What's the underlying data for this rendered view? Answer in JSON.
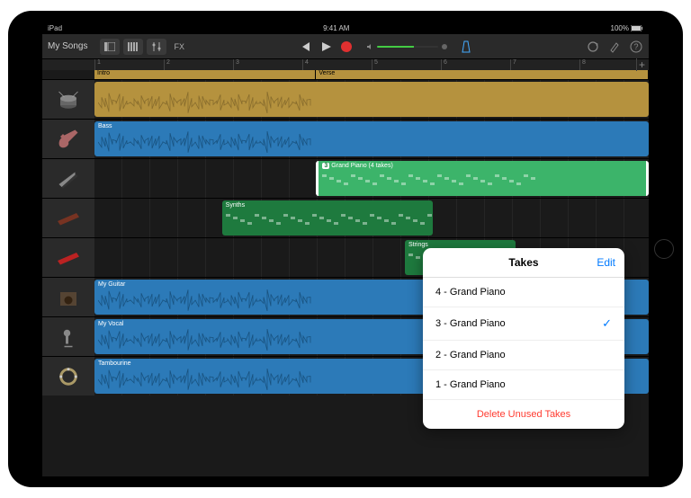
{
  "status": {
    "device": "iPad",
    "time": "9:41 AM",
    "battery": "100%"
  },
  "toolbar": {
    "my_songs": "My Songs",
    "fx": "FX"
  },
  "ruler": {
    "bars": [
      "1",
      "2",
      "3",
      "4",
      "5",
      "6",
      "7",
      "8"
    ]
  },
  "markers": [
    {
      "label": "Intro",
      "width": "40%"
    },
    {
      "label": "Verse",
      "width": "60%"
    }
  ],
  "tracks": [
    {
      "icon": "drums",
      "clips": [
        {
          "kind": "yellow",
          "left": "0%",
          "width": "100%",
          "label": ""
        }
      ]
    },
    {
      "icon": "guitar",
      "clips": [
        {
          "kind": "blue",
          "left": "0%",
          "width": "100%",
          "label": "Bass"
        }
      ]
    },
    {
      "icon": "piano",
      "clips": [
        {
          "kind": "green",
          "left": "40%",
          "width": "60%",
          "label": "Grand Piano (4 takes)",
          "takeNum": "3"
        }
      ]
    },
    {
      "icon": "keys",
      "clips": [
        {
          "kind": "darkgreen",
          "left": "23%",
          "width": "38%",
          "label": "Synths"
        }
      ]
    },
    {
      "icon": "keys2",
      "clips": [
        {
          "kind": "darkgreen",
          "left": "56%",
          "width": "20%",
          "label": "Strings"
        }
      ]
    },
    {
      "icon": "amp",
      "clips": [
        {
          "kind": "blue",
          "left": "0%",
          "width": "100%",
          "label": "My Guitar"
        }
      ]
    },
    {
      "icon": "mic",
      "clips": [
        {
          "kind": "blue",
          "left": "0%",
          "width": "100%",
          "label": "My Vocal"
        }
      ]
    },
    {
      "icon": "tamb",
      "clips": [
        {
          "kind": "blue",
          "left": "0%",
          "width": "100%",
          "label": "Tambourine"
        }
      ]
    }
  ],
  "popover": {
    "title": "Takes",
    "edit": "Edit",
    "items": [
      {
        "label": "4 - Grand Piano",
        "selected": false
      },
      {
        "label": "3 - Grand Piano",
        "selected": true
      },
      {
        "label": "2 - Grand Piano",
        "selected": false
      },
      {
        "label": "1 - Grand Piano",
        "selected": false
      }
    ],
    "delete": "Delete Unused Takes"
  }
}
